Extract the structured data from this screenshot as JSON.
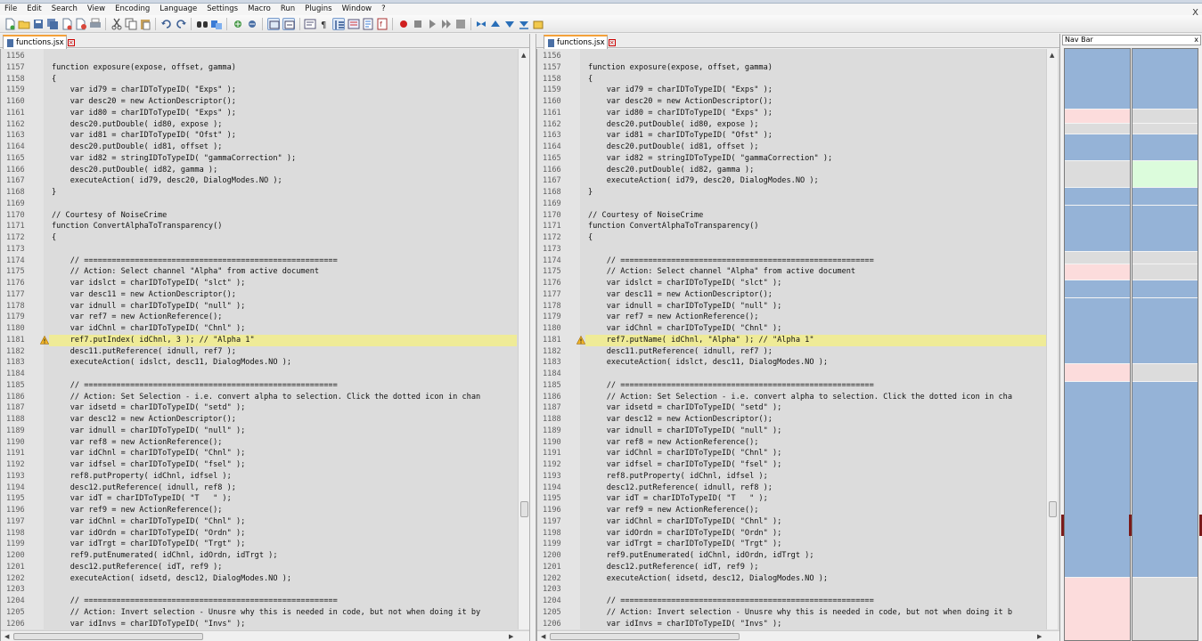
{
  "menu": [
    "File",
    "Edit",
    "Search",
    "View",
    "Encoding",
    "Language",
    "Settings",
    "Macro",
    "Run",
    "Plugins",
    "Window",
    "?"
  ],
  "window_close": "X",
  "tabs": {
    "left": "functions.jsx",
    "right": "functions.jsx"
  },
  "nav_bar": {
    "title": "Nav Bar",
    "close": "x"
  },
  "colors": {
    "editor_bg": "#dcdcdc",
    "highlight": "#efeb97",
    "nav_blue": "#95b3d7",
    "nav_pink": "#fcdcdc",
    "nav_green": "#dcfcdc",
    "nav_grey": "#dcdcdc",
    "tab_accent": "#f4a13a"
  },
  "left_editor": {
    "lines": [
      {
        "n": "1156",
        "t": ""
      },
      {
        "n": "1157",
        "t": "function exposure(expose, offset, gamma)"
      },
      {
        "n": "1158",
        "t": "{"
      },
      {
        "n": "1159",
        "t": "    var id79 = charIDToTypeID( \"Exps\" );"
      },
      {
        "n": "1160",
        "t": "    var desc20 = new ActionDescriptor();"
      },
      {
        "n": "1161",
        "t": "    var id80 = charIDToTypeID( \"Exps\" );"
      },
      {
        "n": "1162",
        "t": "    desc20.putDouble( id80, expose );"
      },
      {
        "n": "1163",
        "t": "    var id81 = charIDToTypeID( \"Ofst\" );"
      },
      {
        "n": "1164",
        "t": "    desc20.putDouble( id81, offset );"
      },
      {
        "n": "1165",
        "t": "    var id82 = stringIDToTypeID( \"gammaCorrection\" );"
      },
      {
        "n": "1166",
        "t": "    desc20.putDouble( id82, gamma );"
      },
      {
        "n": "1167",
        "t": "    executeAction( id79, desc20, DialogModes.NO );"
      },
      {
        "n": "1168",
        "t": "}"
      },
      {
        "n": "1169",
        "t": ""
      },
      {
        "n": "1170",
        "t": "// Courtesy of NoiseCrime"
      },
      {
        "n": "1171",
        "t": "function ConvertAlphaToTransparency()"
      },
      {
        "n": "1172",
        "t": "{"
      },
      {
        "n": "1173",
        "t": ""
      },
      {
        "n": "1174",
        "t": "    // ======================================================="
      },
      {
        "n": "1175",
        "t": "    // Action: Select channel \"Alpha\" from active document"
      },
      {
        "n": "1176",
        "t": "    var idslct = charIDToTypeID( \"slct\" );"
      },
      {
        "n": "1177",
        "t": "    var desc11 = new ActionDescriptor();"
      },
      {
        "n": "1178",
        "t": "    var idnull = charIDToTypeID( \"null\" );"
      },
      {
        "n": "1179",
        "t": "    var ref7 = new ActionReference();"
      },
      {
        "n": "1180",
        "t": "    var idChnl = charIDToTypeID( \"Chnl\" );"
      },
      {
        "n": "1181",
        "t": "    ref7.putIndex( idChnl, 3 ); // \"Alpha 1\"",
        "hl": true
      },
      {
        "n": "1182",
        "t": "    desc11.putReference( idnull, ref7 );"
      },
      {
        "n": "1183",
        "t": "    executeAction( idslct, desc11, DialogModes.NO );"
      },
      {
        "n": "1184",
        "t": ""
      },
      {
        "n": "1185",
        "t": "    // ======================================================="
      },
      {
        "n": "1186",
        "t": "    // Action: Set Selection - i.e. convert alpha to selection. Click the dotted icon in chan"
      },
      {
        "n": "1187",
        "t": "    var idsetd = charIDToTypeID( \"setd\" );"
      },
      {
        "n": "1188",
        "t": "    var desc12 = new ActionDescriptor();"
      },
      {
        "n": "1189",
        "t": "    var idnull = charIDToTypeID( \"null\" );"
      },
      {
        "n": "1190",
        "t": "    var ref8 = new ActionReference();"
      },
      {
        "n": "1191",
        "t": "    var idChnl = charIDToTypeID( \"Chnl\" );"
      },
      {
        "n": "1192",
        "t": "    var idfsel = charIDToTypeID( \"fsel\" );"
      },
      {
        "n": "1193",
        "t": "    ref8.putProperty( idChnl, idfsel );"
      },
      {
        "n": "1194",
        "t": "    desc12.putReference( idnull, ref8 );"
      },
      {
        "n": "1195",
        "t": "    var idT = charIDToTypeID( \"T   \" );"
      },
      {
        "n": "1196",
        "t": "    var ref9 = new ActionReference();"
      },
      {
        "n": "1197",
        "t": "    var idChnl = charIDToTypeID( \"Chnl\" );"
      },
      {
        "n": "1198",
        "t": "    var idOrdn = charIDToTypeID( \"Ordn\" );"
      },
      {
        "n": "1199",
        "t": "    var idTrgt = charIDToTypeID( \"Trgt\" );"
      },
      {
        "n": "1200",
        "t": "    ref9.putEnumerated( idChnl, idOrdn, idTrgt );"
      },
      {
        "n": "1201",
        "t": "    desc12.putReference( idT, ref9 );"
      },
      {
        "n": "1202",
        "t": "    executeAction( idsetd, desc12, DialogModes.NO );"
      },
      {
        "n": "1203",
        "t": ""
      },
      {
        "n": "1204",
        "t": "    // ======================================================="
      },
      {
        "n": "1205",
        "t": "    // Action: Invert selection - Unusre why this is needed in code, but not when doing it by"
      },
      {
        "n": "1206",
        "t": "    var idInvs = charIDToTypeID( \"Invs\" );"
      }
    ]
  },
  "right_editor": {
    "lines": [
      {
        "n": "1156",
        "t": ""
      },
      {
        "n": "1157",
        "t": "function exposure(expose, offset, gamma)"
      },
      {
        "n": "1158",
        "t": "{"
      },
      {
        "n": "1159",
        "t": "    var id79 = charIDToTypeID( \"Exps\" );"
      },
      {
        "n": "1160",
        "t": "    var desc20 = new ActionDescriptor();"
      },
      {
        "n": "1161",
        "t": "    var id80 = charIDToTypeID( \"Exps\" );"
      },
      {
        "n": "1162",
        "t": "    desc20.putDouble( id80, expose );"
      },
      {
        "n": "1163",
        "t": "    var id81 = charIDToTypeID( \"Ofst\" );"
      },
      {
        "n": "1164",
        "t": "    desc20.putDouble( id81, offset );"
      },
      {
        "n": "1165",
        "t": "    var id82 = stringIDToTypeID( \"gammaCorrection\" );"
      },
      {
        "n": "1166",
        "t": "    desc20.putDouble( id82, gamma );"
      },
      {
        "n": "1167",
        "t": "    executeAction( id79, desc20, DialogModes.NO );"
      },
      {
        "n": "1168",
        "t": "}"
      },
      {
        "n": "1169",
        "t": ""
      },
      {
        "n": "1170",
        "t": "// Courtesy of NoiseCrime"
      },
      {
        "n": "1171",
        "t": "function ConvertAlphaToTransparency()"
      },
      {
        "n": "1172",
        "t": "{"
      },
      {
        "n": "1173",
        "t": ""
      },
      {
        "n": "1174",
        "t": "    // ======================================================="
      },
      {
        "n": "1175",
        "t": "    // Action: Select channel \"Alpha\" from active document"
      },
      {
        "n": "1176",
        "t": "    var idslct = charIDToTypeID( \"slct\" );"
      },
      {
        "n": "1177",
        "t": "    var desc11 = new ActionDescriptor();"
      },
      {
        "n": "1178",
        "t": "    var idnull = charIDToTypeID( \"null\" );"
      },
      {
        "n": "1179",
        "t": "    var ref7 = new ActionReference();"
      },
      {
        "n": "1180",
        "t": "    var idChnl = charIDToTypeID( \"Chnl\" );"
      },
      {
        "n": "1181",
        "t": "    ref7.putName( idChnl, \"Alpha\" ); // \"Alpha 1\"",
        "hl": true
      },
      {
        "n": "1182",
        "t": "    desc11.putReference( idnull, ref7 );"
      },
      {
        "n": "1183",
        "t": "    executeAction( idslct, desc11, DialogModes.NO );"
      },
      {
        "n": "1184",
        "t": ""
      },
      {
        "n": "1185",
        "t": "    // ======================================================="
      },
      {
        "n": "1186",
        "t": "    // Action: Set Selection - i.e. convert alpha to selection. Click the dotted icon in cha"
      },
      {
        "n": "1187",
        "t": "    var idsetd = charIDToTypeID( \"setd\" );"
      },
      {
        "n": "1188",
        "t": "    var desc12 = new ActionDescriptor();"
      },
      {
        "n": "1189",
        "t": "    var idnull = charIDToTypeID( \"null\" );"
      },
      {
        "n": "1190",
        "t": "    var ref8 = new ActionReference();"
      },
      {
        "n": "1191",
        "t": "    var idChnl = charIDToTypeID( \"Chnl\" );"
      },
      {
        "n": "1192",
        "t": "    var idfsel = charIDToTypeID( \"fsel\" );"
      },
      {
        "n": "1193",
        "t": "    ref8.putProperty( idChnl, idfsel );"
      },
      {
        "n": "1194",
        "t": "    desc12.putReference( idnull, ref8 );"
      },
      {
        "n": "1195",
        "t": "    var idT = charIDToTypeID( \"T   \" );"
      },
      {
        "n": "1196",
        "t": "    var ref9 = new ActionReference();"
      },
      {
        "n": "1197",
        "t": "    var idChnl = charIDToTypeID( \"Chnl\" );"
      },
      {
        "n": "1198",
        "t": "    var idOrdn = charIDToTypeID( \"Ordn\" );"
      },
      {
        "n": "1199",
        "t": "    var idTrgt = charIDToTypeID( \"Trgt\" );"
      },
      {
        "n": "1200",
        "t": "    ref9.putEnumerated( idChnl, idOrdn, idTrgt );"
      },
      {
        "n": "1201",
        "t": "    desc12.putReference( idT, ref9 );"
      },
      {
        "n": "1202",
        "t": "    executeAction( idsetd, desc12, DialogModes.NO );"
      },
      {
        "n": "1203",
        "t": ""
      },
      {
        "n": "1204",
        "t": "    // ======================================================="
      },
      {
        "n": "1205",
        "t": "    // Action: Invert selection - Unusre why this is needed in code, but not when doing it b"
      },
      {
        "n": "1206",
        "t": "    var idInvs = charIDToTypeID( \"Invs\" );"
      }
    ]
  }
}
